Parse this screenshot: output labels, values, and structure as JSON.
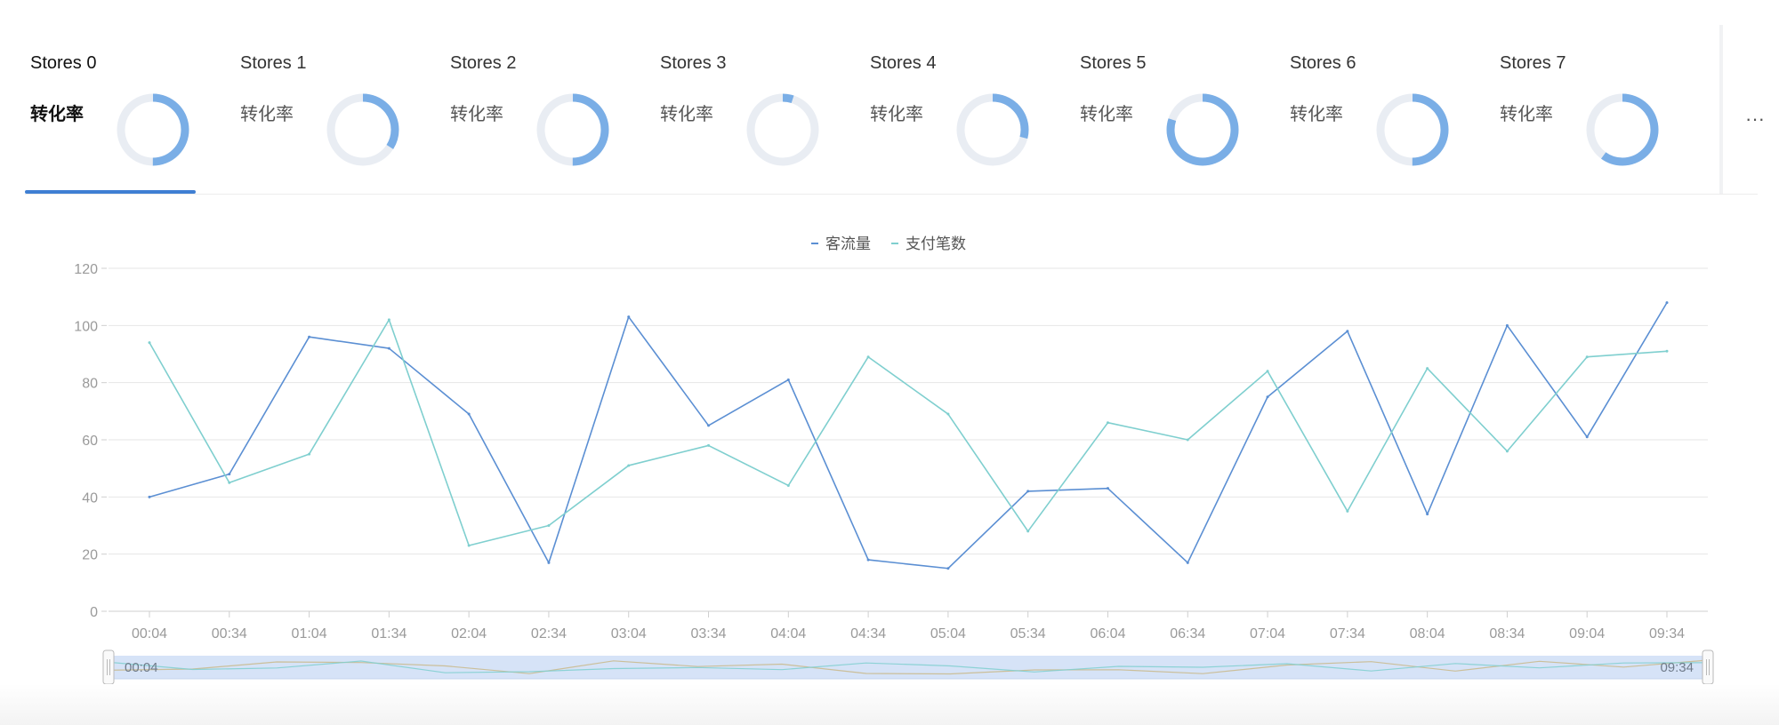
{
  "tabs": [
    {
      "name": "Stores 0",
      "label": "转化率",
      "rate": 0.5
    },
    {
      "name": "Stores 1",
      "label": "转化率",
      "rate": 0.34
    },
    {
      "name": "Stores 2",
      "label": "转化率",
      "rate": 0.5
    },
    {
      "name": "Stores 3",
      "label": "转化率",
      "rate": 0.05
    },
    {
      "name": "Stores 4",
      "label": "转化率",
      "rate": 0.29
    },
    {
      "name": "Stores 5",
      "label": "转化率",
      "rate": 0.8
    },
    {
      "name": "Stores 6",
      "label": "转化率",
      "rate": 0.5
    },
    {
      "name": "Stores 7",
      "label": "转化率",
      "rate": 0.6
    }
  ],
  "active_tab": 0,
  "more_label": "···",
  "colors": {
    "ring_fill": "#7aaee6",
    "ring_track": "#e9edf3",
    "accent": "#3f7fd3",
    "series_0": "#5b8fd3",
    "series_1": "#7fcfcf",
    "grid": "#e6e6e6",
    "axis_text": "#9a9a9a",
    "zoom_fill": "#d6e3f7",
    "zoom_line_2": "#c9b98a"
  },
  "chart_data": {
    "type": "line",
    "x": [
      "00:04",
      "00:34",
      "01:04",
      "01:34",
      "02:04",
      "02:34",
      "03:04",
      "03:34",
      "04:04",
      "04:34",
      "05:04",
      "05:34",
      "06:04",
      "06:34",
      "07:04",
      "07:34",
      "08:04",
      "08:34",
      "09:04",
      "09:34"
    ],
    "series": [
      {
        "name": "客流量",
        "values": [
          40,
          48,
          96,
          92,
          69,
          17,
          103,
          65,
          81,
          18,
          15,
          42,
          43,
          17,
          75,
          98,
          34,
          100,
          61,
          108
        ]
      },
      {
        "name": "支付笔数",
        "values": [
          94,
          45,
          55,
          102,
          23,
          30,
          51,
          58,
          44,
          89,
          69,
          28,
          66,
          60,
          84,
          35,
          85,
          56,
          89,
          91
        ]
      }
    ],
    "ylim": [
      0,
      120
    ],
    "yticks": [
      "0",
      "20",
      "40",
      "60",
      "80",
      "100",
      "120"
    ],
    "legend": "top-center",
    "grid": true,
    "zoom": {
      "start_label": "00:04",
      "end_label": "09:34"
    }
  }
}
